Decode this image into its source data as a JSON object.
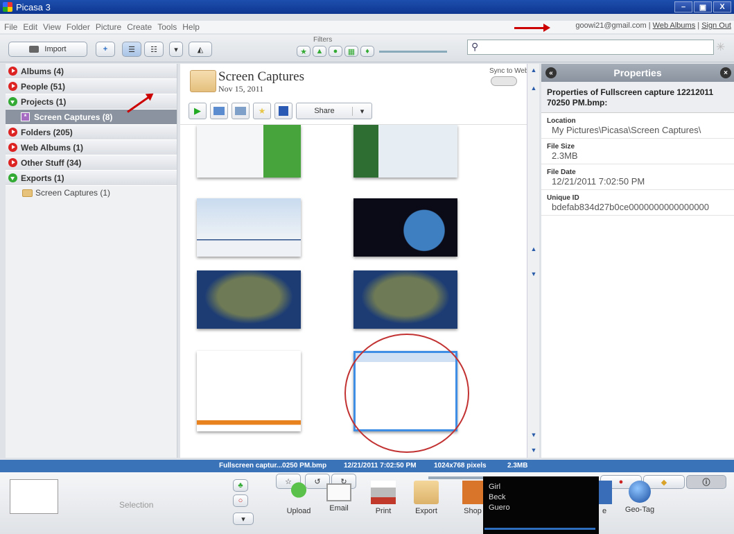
{
  "window": {
    "title": "Picasa 3",
    "minimize": "–",
    "maximize": "▣",
    "close": "X"
  },
  "menu": [
    "File",
    "Edit",
    "View",
    "Folder",
    "Picture",
    "Create",
    "Tools",
    "Help"
  ],
  "account": {
    "email": "goowi21@gmail.com",
    "web_albums": "Web Albums",
    "sign_out": "Sign Out",
    "sep": "|"
  },
  "toolbar": {
    "import_label": "Import",
    "filters_label": "Filters",
    "search_placeholder": ""
  },
  "sidebar": {
    "items": [
      {
        "label": "Albums (4)",
        "state": "collapsed"
      },
      {
        "label": "People (51)",
        "state": "collapsed"
      },
      {
        "label": "Projects (1)",
        "state": "expanded"
      },
      {
        "label": "Screen Captures (8)",
        "state": "selected"
      },
      {
        "label": "Folders (205)",
        "state": "collapsed"
      },
      {
        "label": "Web Albums (1)",
        "state": "collapsed"
      },
      {
        "label": "Other Stuff (34)",
        "state": "collapsed"
      },
      {
        "label": "Exports (1)",
        "state": "expanded"
      },
      {
        "label": "Screen Captures (1)",
        "state": "child"
      }
    ]
  },
  "album": {
    "title": "Screen Captures",
    "date": "Nov 15, 2011",
    "sync_label": "Sync to Web",
    "share_label": "Share"
  },
  "properties": {
    "header": "Properties",
    "intro": "Properties of Fullscreen capture 12212011 70250 PM.bmp:",
    "fields": [
      {
        "label": "Location",
        "value": "My Pictures\\Picasa\\Screen Captures\\"
      },
      {
        "label": "File Size",
        "value": "2.3MB"
      },
      {
        "label": "File Date",
        "value": "12/21/2011 7:02:50 PM"
      },
      {
        "label": "Unique ID",
        "value": "bdefab834d27b0ce0000000000000000"
      }
    ]
  },
  "status": {
    "filename": "Fullscreen captur...0250 PM.bmp",
    "date": "12/21/2011 7:02:50 PM",
    "dimensions": "1024x768 pixels",
    "size": "2.3MB"
  },
  "tray": {
    "selection_label": "Selection",
    "buttons": [
      "Upload",
      "Email",
      "Print",
      "Export",
      "Shop",
      "e",
      "Geo-Tag"
    ]
  },
  "popup": {
    "lines": [
      "Girl",
      "Beck",
      "Guero"
    ]
  },
  "colors": {
    "titlebar": "#1d4fae",
    "statusbar": "#3b73b9",
    "annotation": "#c00000",
    "selected_row": "#8a939f"
  }
}
